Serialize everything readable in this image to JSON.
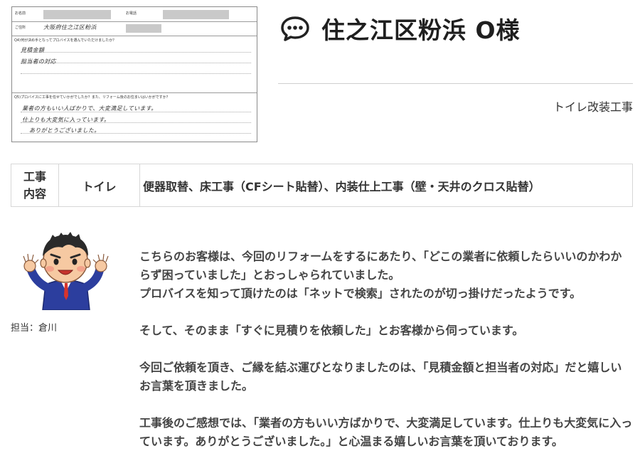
{
  "survey_card": {
    "label_name": "お名前",
    "label_phone": "お電話",
    "label_address": "ご住所",
    "address_handwritten": "大阪府住之江区粉浜",
    "q4_question": "Q4)何が決め手となってプロバイスを選んでいただけましたか？",
    "q4_answers": [
      "見積金額",
      "担当者の対応"
    ],
    "q5_question": "Q5)プロバイスに工事を任せていかがでしたか？また、リフォーム後のお住まいはいかがですか？",
    "q5_answers": [
      "業者の方もいい人ばかりで、大変満足しています。",
      "仕上りも大変気に入っています。",
      "ありがとうございました。"
    ]
  },
  "header": {
    "title": "住之江区粉浜 O様",
    "icon": "speech-bubble-icon",
    "category": "トイレ改装工事"
  },
  "work_table": {
    "heading": "工事\n内容",
    "location": "トイレ",
    "details": "便器取替、床工事（CFシート貼替）、内装仕上工事（壁・天井のクロス貼替）"
  },
  "staff": {
    "label": "担当：倉川"
  },
  "story": {
    "paragraphs": [
      "こちらのお客様は、今回のリフォームをするにあたり、「どこの業者に依頼したらいいのかわからず困っていました」とおっしゃられていました。\nプロバイスを知って頂けたのは「ネットで検索」されたのが切っ掛けだったようです。",
      "そして、そのまま「すぐに見積りを依頼した」とお客様から伺っています。",
      "今回ご依頼を頂き、ご縁を結ぶ運びとなりましたのは、「見積金額と担当者の対応」だと嬉しいお言葉を頂きました。",
      "工事後のご感想では、「業者の方もいい方ばかりで、大変満足しています。仕上りも大変気に入っています。ありがとうございました。」と心温まる嬉しいお言葉を頂いております。"
    ]
  },
  "colors": {
    "text": "#333333",
    "border": "#d7d7d7",
    "mask": "#c9c9c9",
    "suit": "#2c3e9e"
  }
}
